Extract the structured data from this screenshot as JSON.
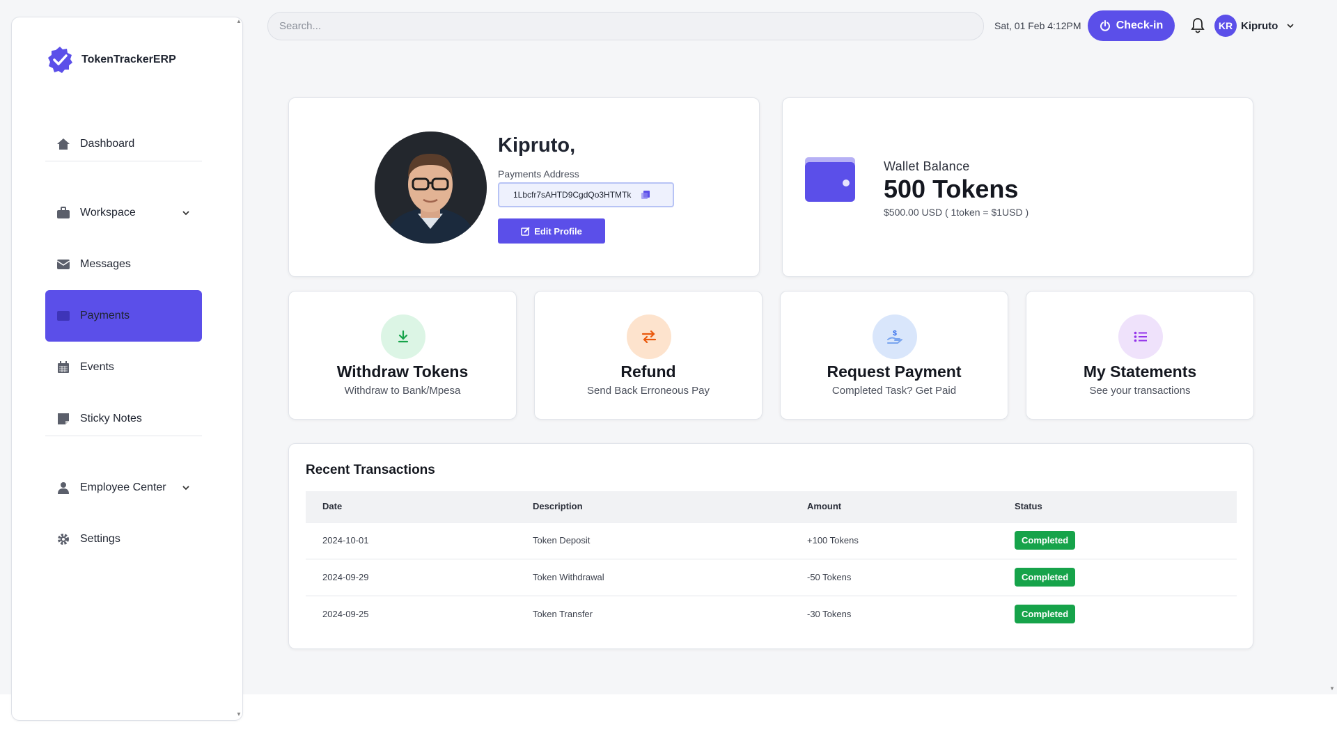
{
  "brand": {
    "name": "TokenTrackerERP"
  },
  "sidebar": {
    "items": [
      {
        "label": "Dashboard"
      },
      {
        "label": "Workspace"
      },
      {
        "label": "Messages"
      },
      {
        "label": "Payments"
      },
      {
        "label": "Events"
      },
      {
        "label": "Sticky Notes"
      },
      {
        "label": "Employee Center"
      },
      {
        "label": "Settings"
      }
    ],
    "active": "Payments"
  },
  "topbar": {
    "search_placeholder": "Search...",
    "datetime": "Sat, 01 Feb 4:12PM",
    "checkin_label": "Check-in",
    "user_initials": "KR",
    "user_name": "Kipruto"
  },
  "profile": {
    "greeting": "Kipruto,",
    "payments_address_label": "Payments Address",
    "payments_address": "1Lbcfr7sAHTD9CgdQo3HTMTk",
    "edit_label": "Edit Profile"
  },
  "wallet": {
    "label": "Wallet Balance",
    "amount": "500 Tokens",
    "usd": "$500.00 USD ( 1token = $1USD )"
  },
  "actions": [
    {
      "title": "Withdraw Tokens",
      "subtitle": "Withdraw to Bank/Mpesa",
      "icon": "download-icon"
    },
    {
      "title": "Refund",
      "subtitle": "Send Back Erroneous Pay",
      "icon": "exchange-icon"
    },
    {
      "title": "Request Payment",
      "subtitle": "Completed Task? Get Paid",
      "icon": "hand-dollar-icon"
    },
    {
      "title": "My Statements",
      "subtitle": "See your transactions",
      "icon": "list-icon"
    }
  ],
  "transactions": {
    "title": "Recent Transactions",
    "columns": [
      "Date",
      "Description",
      "Amount",
      "Status"
    ],
    "rows": [
      {
        "date": "2024-10-01",
        "description": "Token Deposit",
        "amount": "+100 Tokens",
        "status": "Completed"
      },
      {
        "date": "2024-09-29",
        "description": "Token Withdrawal",
        "amount": "-50 Tokens",
        "status": "Completed"
      },
      {
        "date": "2024-09-25",
        "description": "Token Transfer",
        "amount": "-30 Tokens",
        "status": "Completed"
      }
    ]
  },
  "colors": {
    "accent": "#5b4fe9",
    "success": "#16a34a"
  }
}
